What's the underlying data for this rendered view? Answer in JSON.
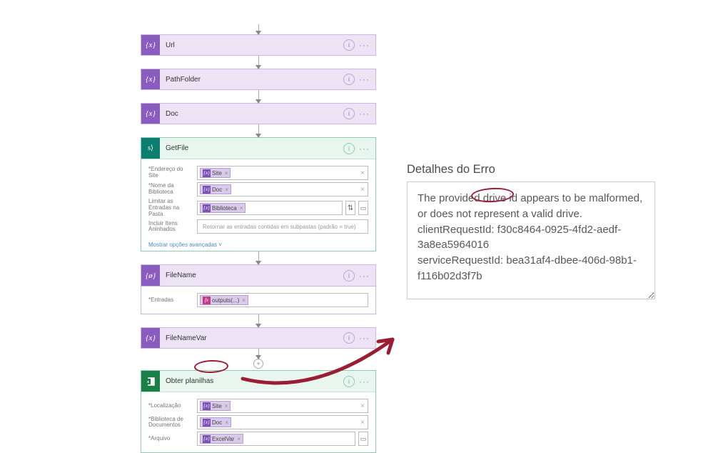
{
  "flow": {
    "steps": {
      "url": {
        "title": "Url"
      },
      "pathfolder": {
        "title": "PathFolder"
      },
      "doc": {
        "title": "Doc"
      },
      "filename": {
        "title": "FileName"
      },
      "filenamevar": {
        "title": "FileNameVar"
      }
    },
    "getfile": {
      "title": "GetFile",
      "fields": {
        "site_label": "*Endereço do Site",
        "site_token": "Site",
        "lib_label": "*Nome da Biblioteca",
        "lib_token": "Doc",
        "limit_label": "Limitar as Entradas na Pasta",
        "limit_token": "Biblioteca",
        "nested_label": "Incluir Itens Aninhados",
        "nested_placeholder": "Retornar as entradas contidas em subpastas (padrão = true)"
      },
      "footer": "Mostrar opções avançadas  ˅"
    },
    "filename_card": {
      "title": "FileName",
      "field_label": "*Entradas",
      "token": "outputs(...)"
    },
    "excel": {
      "title": "Obter planilhas",
      "loc_label": "*Localização",
      "loc_token": "Site",
      "lib_label": "*Biblioteca de Documentos",
      "lib_token": "Doc",
      "file_label": "*Arquivo",
      "file_token": "ExcelVar"
    }
  },
  "error": {
    "title": "Detalhes do Erro",
    "line1a": "The provided ",
    "line1b": "drive id",
    "line1c": " appears to be",
    "line2": "malformed, or does not represent a valid drive.",
    "line3": "clientRequestId: f30c8464-0925-4fd2-aedf-3a8ea5964016",
    "line4": "serviceRequestId: bea31af4-dbee-406d-98b1-f116b02d3f7b"
  }
}
